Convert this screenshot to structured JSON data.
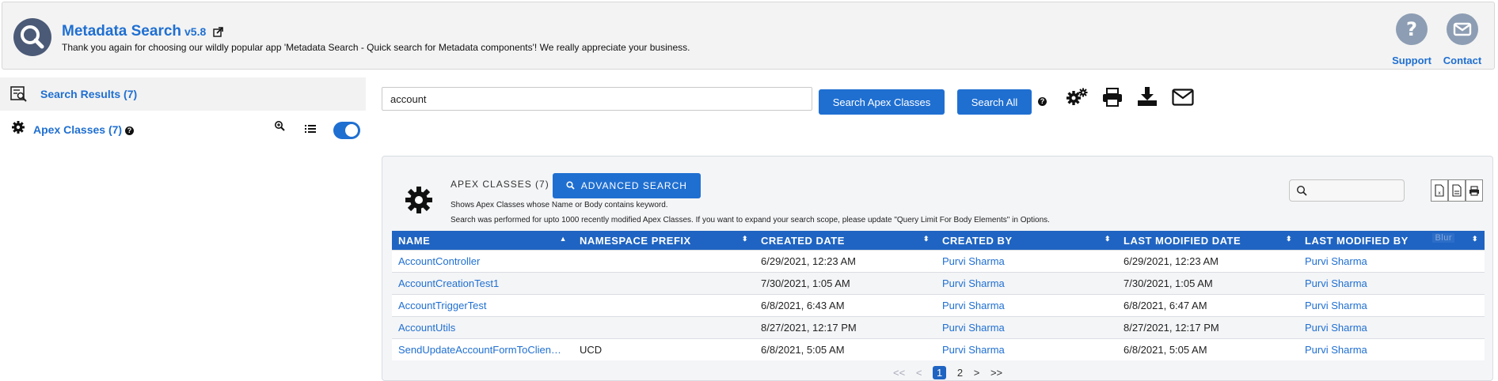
{
  "header": {
    "title": "Metadata Search",
    "version": "v5.8",
    "tagline": "Thank you again for choosing our wildly popular app 'Metadata Search - Quick search for Metadata components'! We really appreciate your business.",
    "support_label": "Support",
    "contact_label": "Contact"
  },
  "sidebar": {
    "results_label": "Search Results (7)",
    "apex_label": "Apex Classes (7)"
  },
  "search": {
    "value": "account",
    "search_apex_label": "Search Apex Classes",
    "search_all_label": "Search All"
  },
  "card": {
    "title": "APEX CLASSES (7)",
    "advanced_label": "ADVANCED SEARCH",
    "desc": "Shows Apex Classes whose Name or Body contains keyword.",
    "note": "Search was performed for upto 1000 recently modified Apex Classes. If you want to expand your search scope, please update \"Query Limit For Body Elements\" in Options."
  },
  "table": {
    "columns": [
      "NAME",
      "NAMESPACE PREFIX",
      "CREATED DATE",
      "CREATED BY",
      "LAST MODIFIED DATE",
      "LAST MODIFIED BY"
    ],
    "blur_label": "Blur",
    "rows": [
      {
        "name": "AccountController",
        "ns": "",
        "created": "6/29/2021, 12:23 AM",
        "created_by": "Purvi Sharma",
        "modified": "6/29/2021, 12:23 AM",
        "modified_by": "Purvi Sharma"
      },
      {
        "name": "AccountCreationTest1",
        "ns": "",
        "created": "7/30/2021, 1:05 AM",
        "created_by": "Purvi Sharma",
        "modified": "7/30/2021, 1:05 AM",
        "modified_by": "Purvi Sharma"
      },
      {
        "name": "AccountTriggerTest",
        "ns": "",
        "created": "6/8/2021, 6:43 AM",
        "created_by": "Purvi Sharma",
        "modified": "6/8/2021, 6:47 AM",
        "modified_by": "Purvi Sharma"
      },
      {
        "name": "AccountUtils",
        "ns": "",
        "created": "8/27/2021, 12:17 PM",
        "created_by": "Purvi Sharma",
        "modified": "8/27/2021, 12:17 PM",
        "modified_by": "Purvi Sharma"
      },
      {
        "name": "SendUpdateAccountFormToClien…",
        "ns": "UCD",
        "created": "6/8/2021, 5:05 AM",
        "created_by": "Purvi Sharma",
        "modified": "6/8/2021, 5:05 AM",
        "modified_by": "Purvi Sharma"
      }
    ]
  },
  "pager": {
    "first": "<<",
    "prev": "<",
    "pages": [
      "1",
      "2"
    ],
    "next": ">",
    "last": ">>"
  },
  "colors": {
    "primary": "#1f6fd1",
    "table_header": "#1f64c2",
    "logo_bg": "#4b5a76",
    "header_icon_bg": "#8d9db3"
  }
}
